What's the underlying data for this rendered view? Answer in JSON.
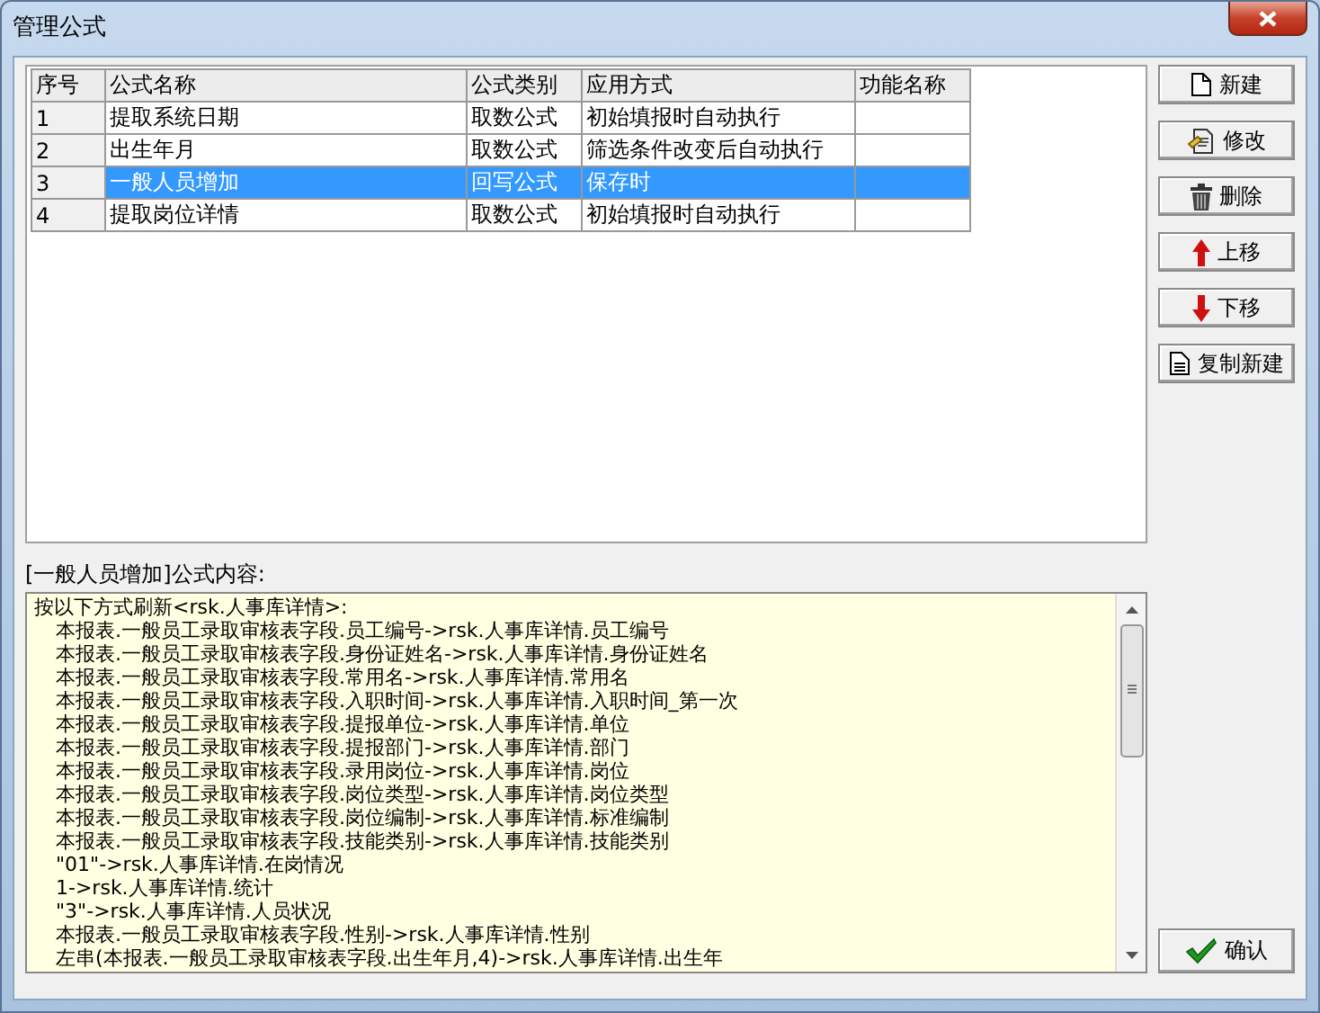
{
  "window": {
    "title": "管理公式"
  },
  "table": {
    "columns": [
      "序号",
      "公式名称",
      "公式类别",
      "应用方式",
      "功能名称"
    ],
    "rows": [
      {
        "cells": [
          "1",
          "提取系统日期",
          "取数公式",
          "初始填报时自动执行",
          ""
        ],
        "selected": false
      },
      {
        "cells": [
          "2",
          "出生年月",
          "取数公式",
          "筛选条件改变后自动执行",
          ""
        ],
        "selected": false
      },
      {
        "cells": [
          "3",
          "一般人员增加",
          "回写公式",
          "保存时",
          ""
        ],
        "selected": true
      },
      {
        "cells": [
          "4",
          "提取岗位详情",
          "取数公式",
          "初始填报时自动执行",
          ""
        ],
        "selected": false
      }
    ]
  },
  "buttons": [
    {
      "label": "新建",
      "kind": "new"
    },
    {
      "label": "修改",
      "kind": "edit"
    },
    {
      "label": "删除",
      "kind": "delete"
    },
    {
      "label": "上移",
      "kind": "up"
    },
    {
      "label": "下移",
      "kind": "down"
    },
    {
      "label": "复制新建",
      "kind": "copy"
    }
  ],
  "content": {
    "label": "[一般人员增加]公式内容:",
    "lines": [
      {
        "text": "按以下方式刷新<rsk.人事库详情>:",
        "kind": "header"
      },
      {
        "text": "本报表.一般员工录取审核表字段.员工编号->rsk.人事库详情.员工编号",
        "kind": "item"
      },
      {
        "text": "本报表.一般员工录取审核表字段.身份证姓名->rsk.人事库详情.身份证姓名",
        "kind": "item"
      },
      {
        "text": "本报表.一般员工录取审核表字段.常用名->rsk.人事库详情.常用名",
        "kind": "item"
      },
      {
        "text": "本报表.一般员工录取审核表字段.入职时间->rsk.人事库详情.入职时间_第一次",
        "kind": "item"
      },
      {
        "text": "本报表.一般员工录取审核表字段.提报单位->rsk.人事库详情.单位",
        "kind": "item"
      },
      {
        "text": "本报表.一般员工录取审核表字段.提报部门->rsk.人事库详情.部门",
        "kind": "item"
      },
      {
        "text": "本报表.一般员工录取审核表字段.录用岗位->rsk.人事库详情.岗位",
        "kind": "item"
      },
      {
        "text": "本报表.一般员工录取审核表字段.岗位类型->rsk.人事库详情.岗位类型",
        "kind": "item"
      },
      {
        "text": "本报表.一般员工录取审核表字段.岗位编制->rsk.人事库详情.标准编制",
        "kind": "item"
      },
      {
        "text": "本报表.一般员工录取审核表字段.技能类别->rsk.人事库详情.技能类别",
        "kind": "item"
      },
      {
        "text": "\"01\"->rsk.人事库详情.在岗情况",
        "kind": "item"
      },
      {
        "text": "1->rsk.人事库详情.统计",
        "kind": "item"
      },
      {
        "text": "\"3\"->rsk.人事库详情.人员状况",
        "kind": "item"
      },
      {
        "text": "本报表.一般员工录取审核表字段.性别->rsk.人事库详情.性别",
        "kind": "item"
      },
      {
        "text": "左串(本报表.一般员工录取审核表字段.出生年月,4)->rsk.人事库详情.出生年",
        "kind": "item"
      }
    ]
  },
  "confirm_button": {
    "label": "确认"
  }
}
